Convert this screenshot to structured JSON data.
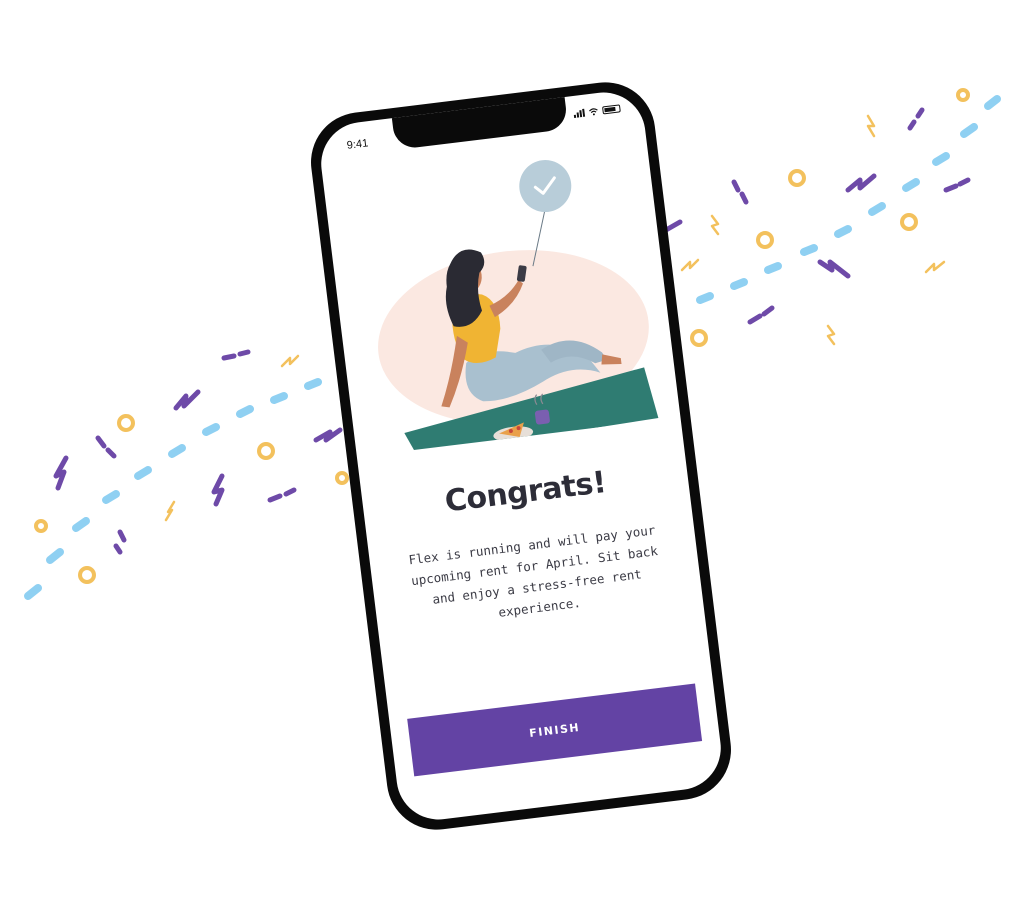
{
  "status_bar": {
    "time": "9:41"
  },
  "screen": {
    "title": "Congrats!",
    "message": "Flex is running and will pay your upcoming rent for April. Sit back and enjoy a stress-free rent experience.",
    "finish_label": "FINISH"
  },
  "colors": {
    "brand_purple": "#6343a4",
    "confetti_blue": "#8fd0f2",
    "confetti_yellow": "#f3c15d",
    "confetti_purple": "#6e4aa8",
    "mat_teal": "#2f7c72",
    "blob_peach": "#fbe8e1",
    "check_circle": "#b8cdd9"
  },
  "icons": {
    "success": "check-circle-icon",
    "signal": "signal-bars-icon",
    "wifi": "wifi-icon",
    "battery": "battery-icon"
  }
}
